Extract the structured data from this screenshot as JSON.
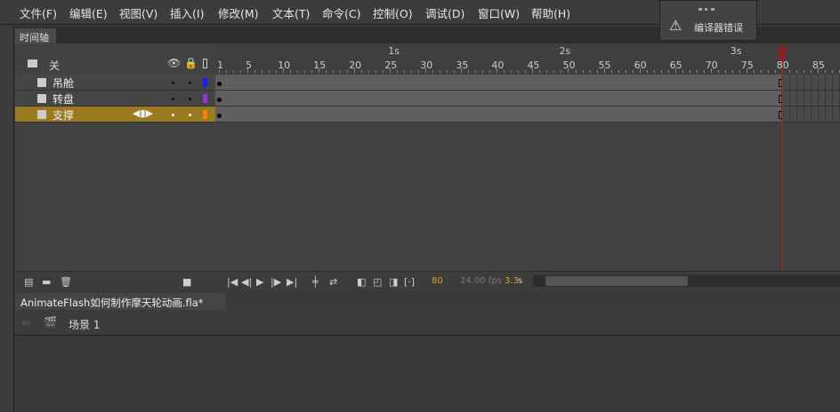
{
  "menu": [
    "文件(F)",
    "编辑(E)",
    "视图(V)",
    "插入(I)",
    "修改(M)",
    "文本(T)",
    "命令(C)",
    "控制(O)",
    "调试(D)",
    "窗口(W)",
    "帮助(H)"
  ],
  "timeline": {
    "tab": "时间轴",
    "header_label": "关",
    "layers": [
      {
        "name": "吊舱",
        "color": "#1a1aff",
        "selected": false
      },
      {
        "name": "转盘",
        "color": "#9a30e0",
        "selected": false
      },
      {
        "name": "支撑",
        "color": "#ff8000",
        "selected": true
      }
    ],
    "ruler_frames": [
      "1",
      "5",
      "10",
      "15",
      "20",
      "25",
      "30",
      "35",
      "40",
      "45",
      "50",
      "55",
      "60",
      "65",
      "70",
      "75",
      "80",
      "85"
    ],
    "seconds": [
      "1s",
      "2s",
      "3s"
    ],
    "current_frame": "80",
    "fps": "24.00 fps",
    "time": "3.3",
    "time_unit": "s",
    "total_frames": 80
  },
  "popup": {
    "message": "编译器错误"
  },
  "document": {
    "tab": "AnimateFlash如何制作摩天轮动画.fla*",
    "close": "×",
    "scene": "场景 1"
  },
  "icons": {
    "play": "▶",
    "first": "|◀",
    "prev": "◀|",
    "next": "|▶",
    "last": "▶|"
  }
}
